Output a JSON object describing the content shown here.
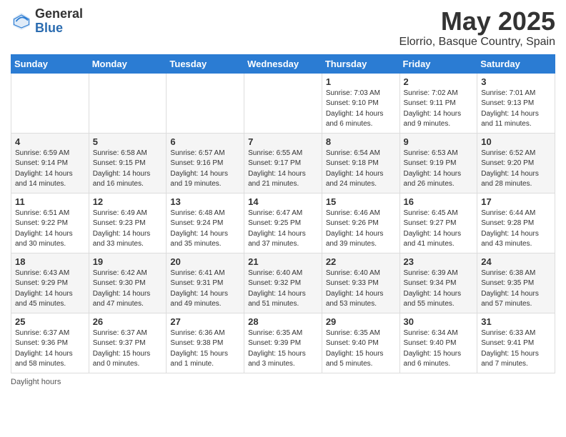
{
  "header": {
    "logo_general": "General",
    "logo_blue": "Blue",
    "month": "May 2025",
    "location": "Elorrio, Basque Country, Spain"
  },
  "weekdays": [
    "Sunday",
    "Monday",
    "Tuesday",
    "Wednesday",
    "Thursday",
    "Friday",
    "Saturday"
  ],
  "footer": "Daylight hours",
  "weeks": [
    [
      {
        "day": "",
        "info": ""
      },
      {
        "day": "",
        "info": ""
      },
      {
        "day": "",
        "info": ""
      },
      {
        "day": "",
        "info": ""
      },
      {
        "day": "1",
        "info": "Sunrise: 7:03 AM\nSunset: 9:10 PM\nDaylight: 14 hours\nand 6 minutes."
      },
      {
        "day": "2",
        "info": "Sunrise: 7:02 AM\nSunset: 9:11 PM\nDaylight: 14 hours\nand 9 minutes."
      },
      {
        "day": "3",
        "info": "Sunrise: 7:01 AM\nSunset: 9:13 PM\nDaylight: 14 hours\nand 11 minutes."
      }
    ],
    [
      {
        "day": "4",
        "info": "Sunrise: 6:59 AM\nSunset: 9:14 PM\nDaylight: 14 hours\nand 14 minutes."
      },
      {
        "day": "5",
        "info": "Sunrise: 6:58 AM\nSunset: 9:15 PM\nDaylight: 14 hours\nand 16 minutes."
      },
      {
        "day": "6",
        "info": "Sunrise: 6:57 AM\nSunset: 9:16 PM\nDaylight: 14 hours\nand 19 minutes."
      },
      {
        "day": "7",
        "info": "Sunrise: 6:55 AM\nSunset: 9:17 PM\nDaylight: 14 hours\nand 21 minutes."
      },
      {
        "day": "8",
        "info": "Sunrise: 6:54 AM\nSunset: 9:18 PM\nDaylight: 14 hours\nand 24 minutes."
      },
      {
        "day": "9",
        "info": "Sunrise: 6:53 AM\nSunset: 9:19 PM\nDaylight: 14 hours\nand 26 minutes."
      },
      {
        "day": "10",
        "info": "Sunrise: 6:52 AM\nSunset: 9:20 PM\nDaylight: 14 hours\nand 28 minutes."
      }
    ],
    [
      {
        "day": "11",
        "info": "Sunrise: 6:51 AM\nSunset: 9:22 PM\nDaylight: 14 hours\nand 30 minutes."
      },
      {
        "day": "12",
        "info": "Sunrise: 6:49 AM\nSunset: 9:23 PM\nDaylight: 14 hours\nand 33 minutes."
      },
      {
        "day": "13",
        "info": "Sunrise: 6:48 AM\nSunset: 9:24 PM\nDaylight: 14 hours\nand 35 minutes."
      },
      {
        "day": "14",
        "info": "Sunrise: 6:47 AM\nSunset: 9:25 PM\nDaylight: 14 hours\nand 37 minutes."
      },
      {
        "day": "15",
        "info": "Sunrise: 6:46 AM\nSunset: 9:26 PM\nDaylight: 14 hours\nand 39 minutes."
      },
      {
        "day": "16",
        "info": "Sunrise: 6:45 AM\nSunset: 9:27 PM\nDaylight: 14 hours\nand 41 minutes."
      },
      {
        "day": "17",
        "info": "Sunrise: 6:44 AM\nSunset: 9:28 PM\nDaylight: 14 hours\nand 43 minutes."
      }
    ],
    [
      {
        "day": "18",
        "info": "Sunrise: 6:43 AM\nSunset: 9:29 PM\nDaylight: 14 hours\nand 45 minutes."
      },
      {
        "day": "19",
        "info": "Sunrise: 6:42 AM\nSunset: 9:30 PM\nDaylight: 14 hours\nand 47 minutes."
      },
      {
        "day": "20",
        "info": "Sunrise: 6:41 AM\nSunset: 9:31 PM\nDaylight: 14 hours\nand 49 minutes."
      },
      {
        "day": "21",
        "info": "Sunrise: 6:40 AM\nSunset: 9:32 PM\nDaylight: 14 hours\nand 51 minutes."
      },
      {
        "day": "22",
        "info": "Sunrise: 6:40 AM\nSunset: 9:33 PM\nDaylight: 14 hours\nand 53 minutes."
      },
      {
        "day": "23",
        "info": "Sunrise: 6:39 AM\nSunset: 9:34 PM\nDaylight: 14 hours\nand 55 minutes."
      },
      {
        "day": "24",
        "info": "Sunrise: 6:38 AM\nSunset: 9:35 PM\nDaylight: 14 hours\nand 57 minutes."
      }
    ],
    [
      {
        "day": "25",
        "info": "Sunrise: 6:37 AM\nSunset: 9:36 PM\nDaylight: 14 hours\nand 58 minutes."
      },
      {
        "day": "26",
        "info": "Sunrise: 6:37 AM\nSunset: 9:37 PM\nDaylight: 15 hours\nand 0 minutes."
      },
      {
        "day": "27",
        "info": "Sunrise: 6:36 AM\nSunset: 9:38 PM\nDaylight: 15 hours\nand 1 minute."
      },
      {
        "day": "28",
        "info": "Sunrise: 6:35 AM\nSunset: 9:39 PM\nDaylight: 15 hours\nand 3 minutes."
      },
      {
        "day": "29",
        "info": "Sunrise: 6:35 AM\nSunset: 9:40 PM\nDaylight: 15 hours\nand 5 minutes."
      },
      {
        "day": "30",
        "info": "Sunrise: 6:34 AM\nSunset: 9:40 PM\nDaylight: 15 hours\nand 6 minutes."
      },
      {
        "day": "31",
        "info": "Sunrise: 6:33 AM\nSunset: 9:41 PM\nDaylight: 15 hours\nand 7 minutes."
      }
    ]
  ]
}
